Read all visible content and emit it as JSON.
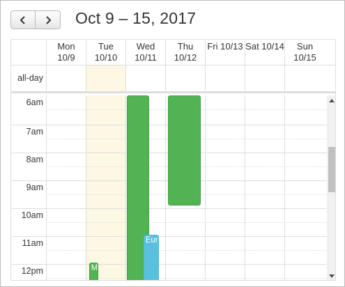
{
  "toolbar": {
    "prev_icon": "chevron-left-icon",
    "next_icon": "chevron-right-icon",
    "title": "Oct 9 – 15, 2017"
  },
  "days": [
    {
      "line1": "Mon",
      "line2": "10/9",
      "today": false
    },
    {
      "line1": "Tue",
      "line2": "10/10",
      "today": true
    },
    {
      "line1": "Wed",
      "line2": "10/11",
      "today": false
    },
    {
      "line1": "Thu",
      "line2": "10/12",
      "today": false
    },
    {
      "line1": "Fri 10/13",
      "line2": "",
      "today": false
    },
    {
      "line1": "Sat 10/14",
      "line2": "",
      "today": false
    },
    {
      "line1": "Sun",
      "line2": "10/15",
      "today": false
    }
  ],
  "allday_label": "all-day",
  "hours": [
    "6am",
    "7am",
    "8am",
    "9am",
    "10am",
    "11am",
    "12pm"
  ],
  "events": [
    {
      "title": "",
      "day": 2,
      "start": 6.0,
      "end": 12.7,
      "color": "#51b351",
      "sub_left": 0.0,
      "sub_width": 0.6
    },
    {
      "title": "",
      "day": 3,
      "start": 6.0,
      "end": 9.95,
      "color": "#51b351",
      "sub_left": 0.04,
      "sub_width": 0.88
    },
    {
      "title": "Eur",
      "day": 2,
      "start": 11.0,
      "end": 12.7,
      "color": "#5bc0de",
      "sub_left": 0.45,
      "sub_width": 0.42
    },
    {
      "title": "M",
      "day": 1,
      "start": 12.0,
      "end": 12.7,
      "color": "#51b351",
      "sub_left": 0.05,
      "sub_width": 0.25
    }
  ],
  "colors": {
    "today_bg": "#fcf8e3",
    "event_green": "#51b351",
    "event_blue": "#5bc0de",
    "grid": "#dddddd"
  },
  "scrollbar": {
    "up_icon": "arrow-up-icon",
    "down_icon": "arrow-down-icon"
  }
}
